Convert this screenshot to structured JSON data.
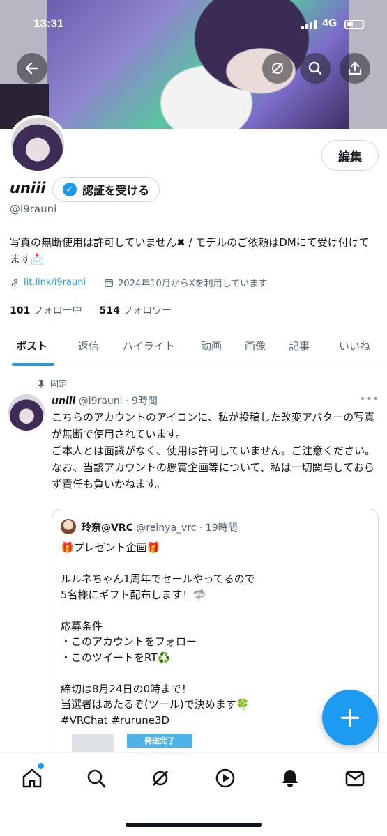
{
  "status_bar": {
    "time": "13:31",
    "network": "4G"
  },
  "banner": {
    "buttons": [
      {
        "name": "back-icon"
      },
      {
        "name": "grok-icon"
      },
      {
        "name": "search-icon"
      },
      {
        "name": "share-icon"
      }
    ]
  },
  "profile": {
    "edit_label": "編集",
    "display_name": "uniii",
    "verify_label": "認証を受ける",
    "handle": "@i9rauni",
    "bio": "写真の無断使用は許可していません✖ / モデルのご依頼はDMにて受け付けてます📩",
    "link": "lit.link/i9rauni",
    "joined": "2024年10月からXを利用しています",
    "following_count": "101",
    "following_label": "フォロー中",
    "followers_count": "514",
    "followers_label": "フォロワー"
  },
  "tabs": [
    "ポスト",
    "返信",
    "ハイライト",
    "動画",
    "画像",
    "記事",
    "いいね"
  ],
  "post": {
    "pinned_label": "固定",
    "author": "uniii",
    "handle": "@i9rauni",
    "time": "9時間",
    "text": "こちらのアカウントのアイコンに、私が投稿した改変アバターの写真が無断で使用されています。\nご本人とは面識がなく、使用は許可していません。ご注意ください。\nなお、当該アカウントの懸賞企画等について、私は一切関与しておらず責任も負いかねます。",
    "quote": {
      "author": "玲奈@VRC",
      "handle": "@reinya_vrc",
      "time": "19時間",
      "text": "🎁プレゼント企画🎁\n\nルルネちゃん1周年でセールやってるので\n5名様にギフト配布します！🦈\n\n応募条件\n・このアカウントをフォロー\n・このツイートをRT♻️\n\n締切は8月24日の0時まで！\n当選者はあたるぞ(ツール)で決めます🍀\n#VRChat  #rurune3D",
      "tag": "発送完了"
    }
  },
  "fab_label": "+",
  "bottom_nav": [
    "home-icon",
    "search-icon",
    "grok-icon",
    "spaces-icon",
    "notifications-icon",
    "messages-icon"
  ],
  "colors": {
    "accent": "#1d9bf0",
    "text": "#0f1419",
    "muted": "#536471"
  }
}
